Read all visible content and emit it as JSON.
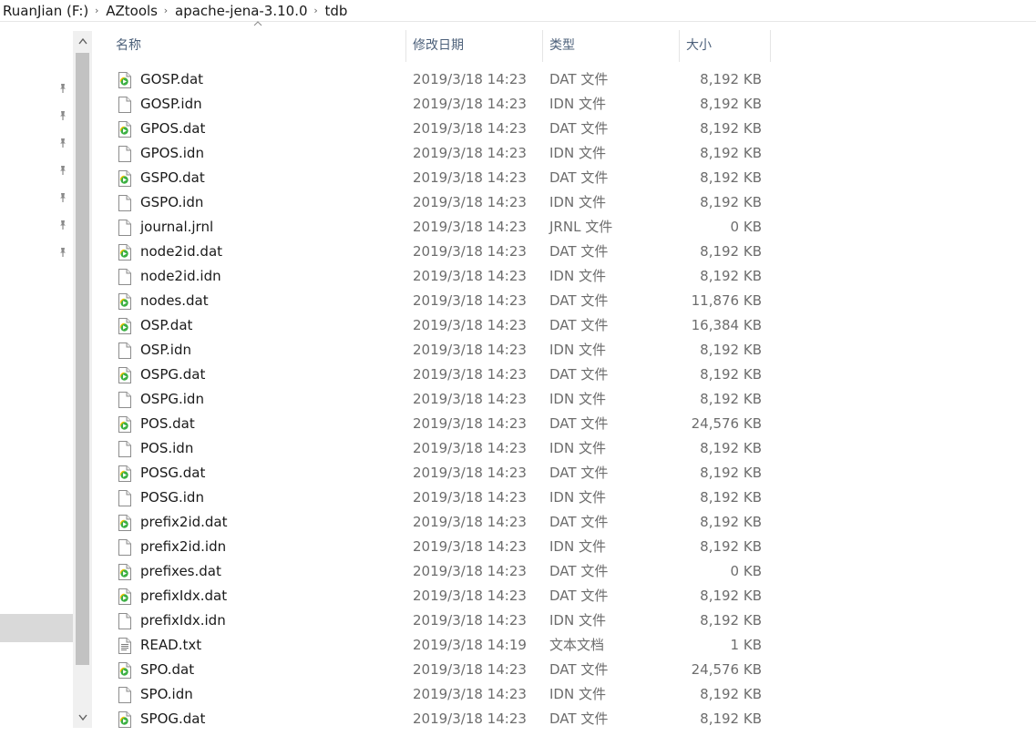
{
  "breadcrumb": {
    "items": [
      "RuanJian (F:)",
      "AZtools",
      "apache-jena-3.10.0",
      "tdb"
    ],
    "separator": "›"
  },
  "columns": {
    "name": "名称",
    "date": "修改日期",
    "type": "类型",
    "size": "大小"
  },
  "sort_indicator": "^",
  "scroll": {
    "up": "^",
    "down": "v"
  },
  "pins": [
    "pin-icon",
    "pin-icon",
    "pin-icon",
    "pin-icon",
    "pin-icon",
    "pin-icon",
    "pin-icon"
  ],
  "files": [
    {
      "name": "GOSP.dat",
      "date": "2019/3/18 14:23",
      "type": "DAT 文件",
      "size": "8,192 KB",
      "icon": "media-file-icon"
    },
    {
      "name": "GOSP.idn",
      "date": "2019/3/18 14:23",
      "type": "IDN 文件",
      "size": "8,192 KB",
      "icon": "blank-file-icon"
    },
    {
      "name": "GPOS.dat",
      "date": "2019/3/18 14:23",
      "type": "DAT 文件",
      "size": "8,192 KB",
      "icon": "media-file-icon"
    },
    {
      "name": "GPOS.idn",
      "date": "2019/3/18 14:23",
      "type": "IDN 文件",
      "size": "8,192 KB",
      "icon": "blank-file-icon"
    },
    {
      "name": "GSPO.dat",
      "date": "2019/3/18 14:23",
      "type": "DAT 文件",
      "size": "8,192 KB",
      "icon": "media-file-icon"
    },
    {
      "name": "GSPO.idn",
      "date": "2019/3/18 14:23",
      "type": "IDN 文件",
      "size": "8,192 KB",
      "icon": "blank-file-icon"
    },
    {
      "name": "journal.jrnl",
      "date": "2019/3/18 14:23",
      "type": "JRNL 文件",
      "size": "0 KB",
      "icon": "blank-file-icon"
    },
    {
      "name": "node2id.dat",
      "date": "2019/3/18 14:23",
      "type": "DAT 文件",
      "size": "8,192 KB",
      "icon": "media-file-icon"
    },
    {
      "name": "node2id.idn",
      "date": "2019/3/18 14:23",
      "type": "IDN 文件",
      "size": "8,192 KB",
      "icon": "blank-file-icon"
    },
    {
      "name": "nodes.dat",
      "date": "2019/3/18 14:23",
      "type": "DAT 文件",
      "size": "11,876 KB",
      "icon": "media-file-icon"
    },
    {
      "name": "OSP.dat",
      "date": "2019/3/18 14:23",
      "type": "DAT 文件",
      "size": "16,384 KB",
      "icon": "media-file-icon"
    },
    {
      "name": "OSP.idn",
      "date": "2019/3/18 14:23",
      "type": "IDN 文件",
      "size": "8,192 KB",
      "icon": "blank-file-icon"
    },
    {
      "name": "OSPG.dat",
      "date": "2019/3/18 14:23",
      "type": "DAT 文件",
      "size": "8,192 KB",
      "icon": "media-file-icon"
    },
    {
      "name": "OSPG.idn",
      "date": "2019/3/18 14:23",
      "type": "IDN 文件",
      "size": "8,192 KB",
      "icon": "blank-file-icon"
    },
    {
      "name": "POS.dat",
      "date": "2019/3/18 14:23",
      "type": "DAT 文件",
      "size": "24,576 KB",
      "icon": "media-file-icon"
    },
    {
      "name": "POS.idn",
      "date": "2019/3/18 14:23",
      "type": "IDN 文件",
      "size": "8,192 KB",
      "icon": "blank-file-icon"
    },
    {
      "name": "POSG.dat",
      "date": "2019/3/18 14:23",
      "type": "DAT 文件",
      "size": "8,192 KB",
      "icon": "media-file-icon"
    },
    {
      "name": "POSG.idn",
      "date": "2019/3/18 14:23",
      "type": "IDN 文件",
      "size": "8,192 KB",
      "icon": "blank-file-icon"
    },
    {
      "name": "prefix2id.dat",
      "date": "2019/3/18 14:23",
      "type": "DAT 文件",
      "size": "8,192 KB",
      "icon": "media-file-icon"
    },
    {
      "name": "prefix2id.idn",
      "date": "2019/3/18 14:23",
      "type": "IDN 文件",
      "size": "8,192 KB",
      "icon": "blank-file-icon"
    },
    {
      "name": "prefixes.dat",
      "date": "2019/3/18 14:23",
      "type": "DAT 文件",
      "size": "0 KB",
      "icon": "media-file-icon"
    },
    {
      "name": "prefixIdx.dat",
      "date": "2019/3/18 14:23",
      "type": "DAT 文件",
      "size": "8,192 KB",
      "icon": "media-file-icon"
    },
    {
      "name": "prefixIdx.idn",
      "date": "2019/3/18 14:23",
      "type": "IDN 文件",
      "size": "8,192 KB",
      "icon": "blank-file-icon"
    },
    {
      "name": "READ.txt",
      "date": "2019/3/18 14:19",
      "type": "文本文档",
      "size": "1 KB",
      "icon": "text-file-icon"
    },
    {
      "name": "SPO.dat",
      "date": "2019/3/18 14:23",
      "type": "DAT 文件",
      "size": "24,576 KB",
      "icon": "media-file-icon"
    },
    {
      "name": "SPO.idn",
      "date": "2019/3/18 14:23",
      "type": "IDN 文件",
      "size": "8,192 KB",
      "icon": "blank-file-icon"
    },
    {
      "name": "SPOG.dat",
      "date": "2019/3/18 14:23",
      "type": "DAT 文件",
      "size": "8,192 KB",
      "icon": "media-file-icon"
    }
  ]
}
